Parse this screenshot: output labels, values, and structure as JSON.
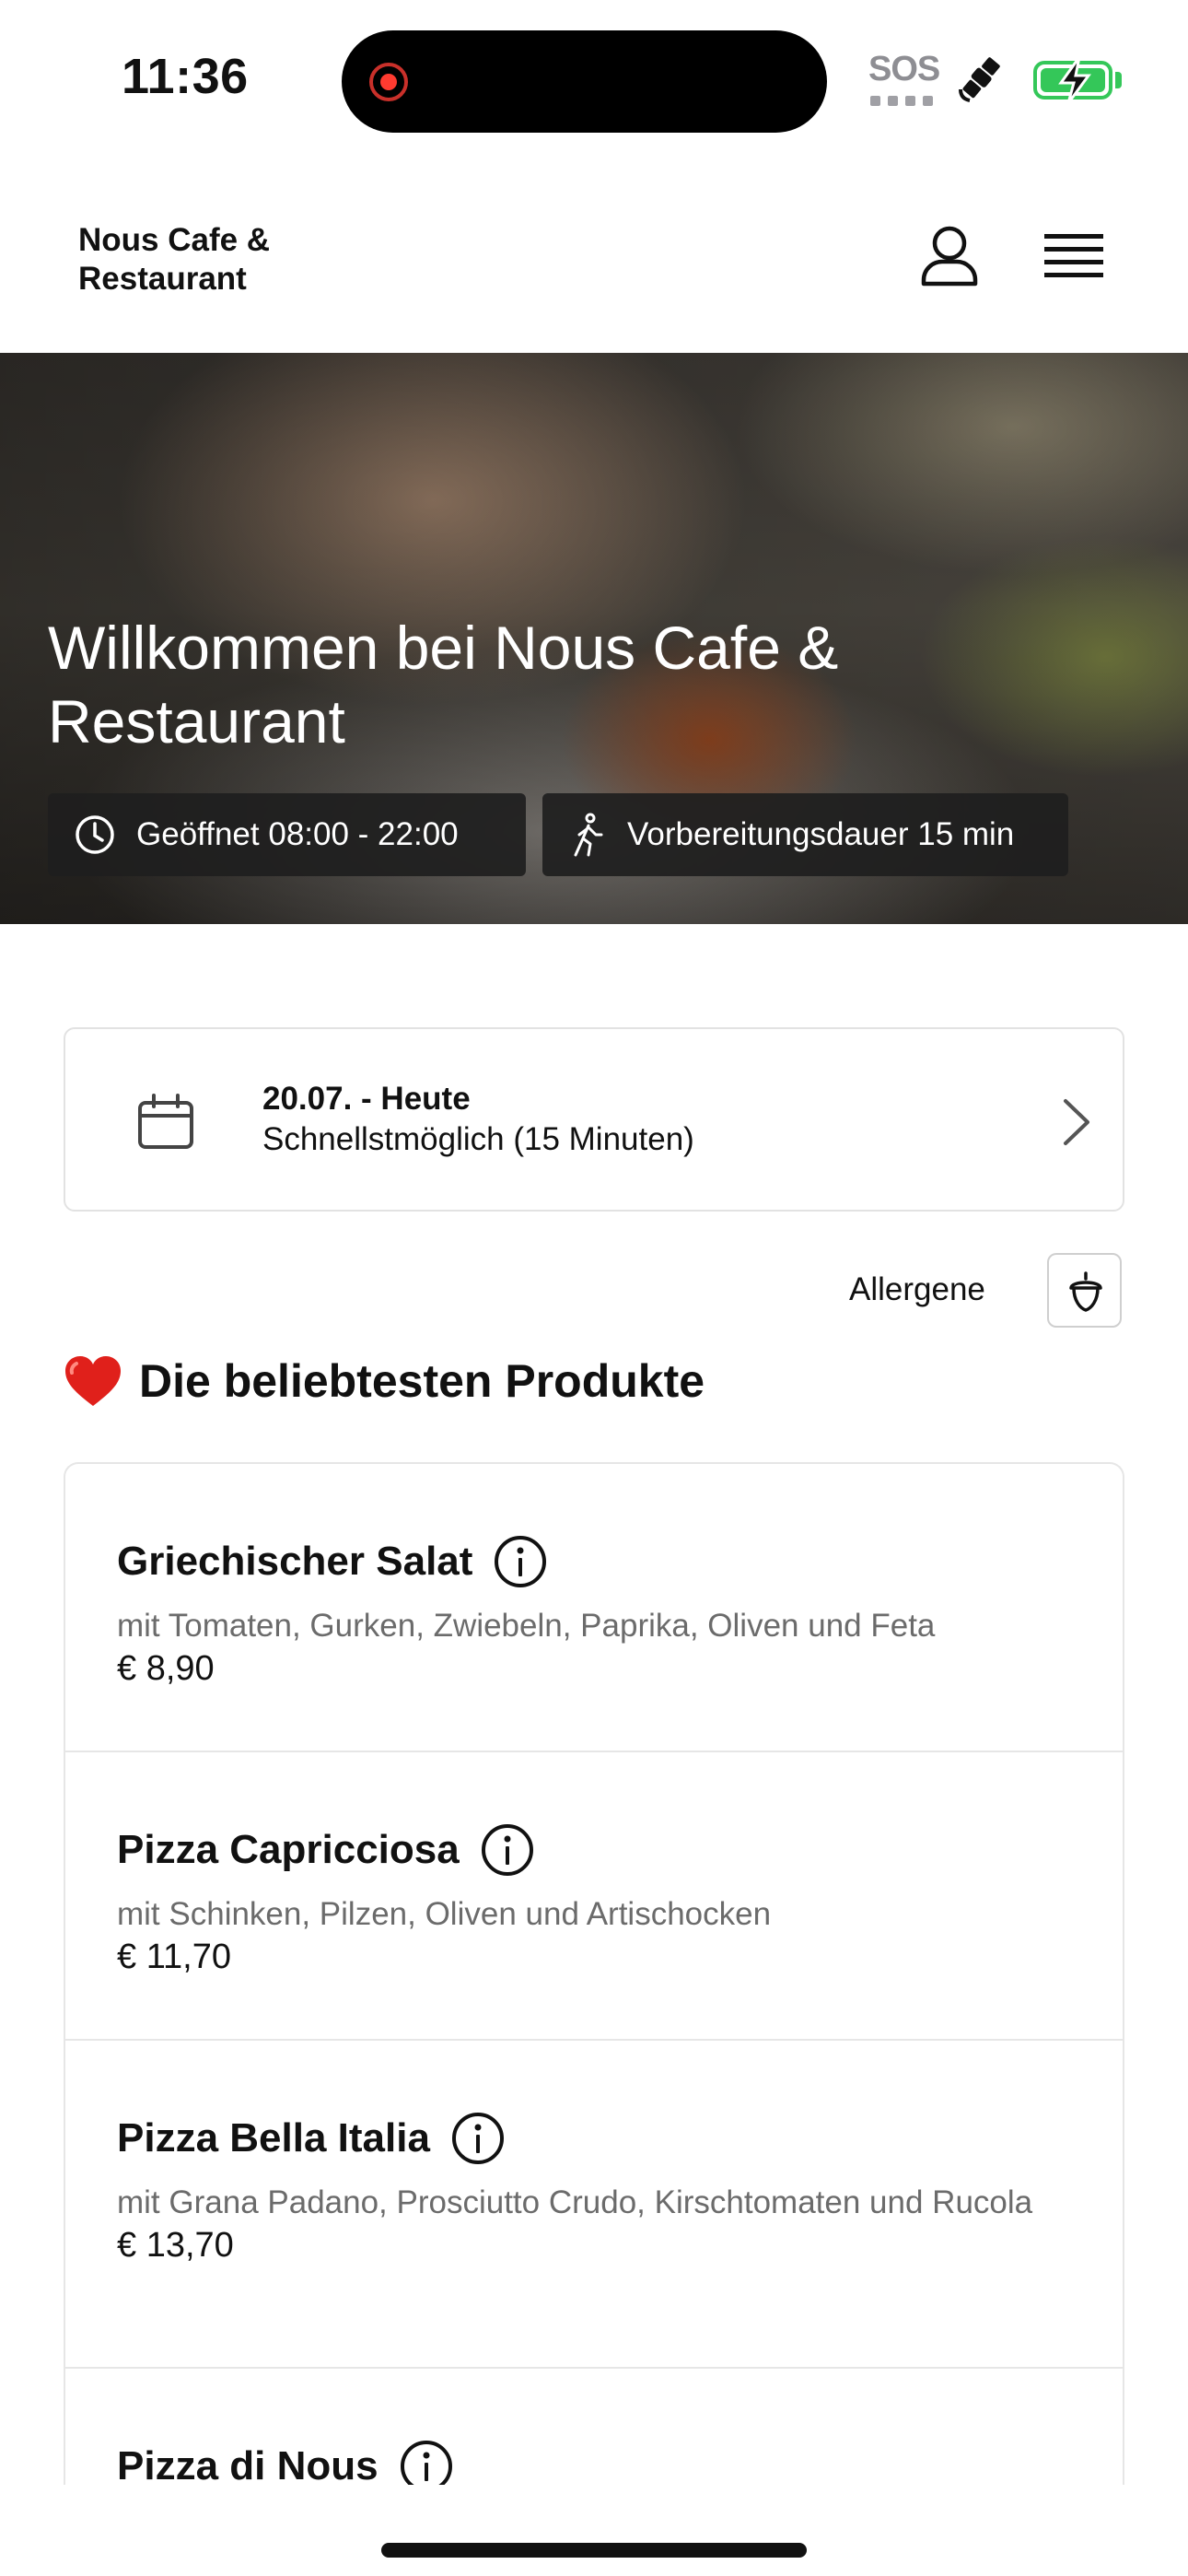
{
  "status_bar": {
    "time": "11:36",
    "sos": "SOS",
    "battery_color": "#34c759",
    "record_color": "#ff3b30"
  },
  "header": {
    "brand": "Nous Cafe & Restaurant",
    "user_icon": "user-icon",
    "menu_icon": "hamburger-menu-icon"
  },
  "hero": {
    "title": "Willkommen bei Nous Cafe & Restaurant",
    "opening_hours": "Geöffnet 08:00 - 22:00",
    "prep_time": "Vorbereitungsdauer 15 min"
  },
  "date_selector": {
    "date": "20.07. - Heute",
    "time_option": "Schnellstmöglich (15 Minuten)"
  },
  "allergens": {
    "label": "Allergene"
  },
  "popular": {
    "title": "Die beliebtesten Produkte",
    "products": [
      {
        "name": "Griechischer Salat",
        "description": "mit Tomaten, Gurken, Zwiebeln, Paprika, Oliven und Feta",
        "price": "€ 8,90"
      },
      {
        "name": "Pizza Capricciosa",
        "description": "mit Schinken, Pilzen, Oliven und Artischocken",
        "price": "€ 11,70"
      },
      {
        "name": "Pizza Bella Italia",
        "description": "mit Grana Padano, Prosciutto Crudo, Kirschtomaten und Rucola",
        "price": "€ 13,70"
      },
      {
        "name": "Pizza di Nous",
        "description": "",
        "price": ""
      }
    ]
  }
}
